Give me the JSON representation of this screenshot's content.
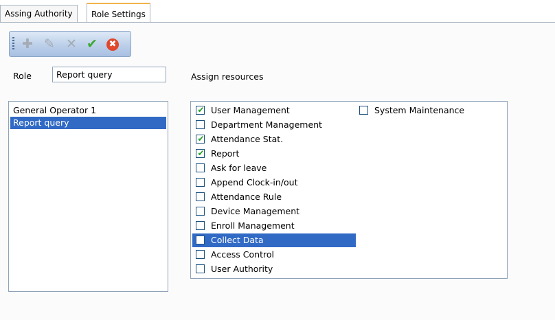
{
  "tabs": [
    {
      "label": "Assing Authority",
      "active": false
    },
    {
      "label": "Role Settings",
      "active": true
    }
  ],
  "toolbar": {
    "buttons": [
      {
        "icon": "plus-icon",
        "glyph": "✚",
        "enabled": false
      },
      {
        "icon": "edit-icon",
        "glyph": "✎",
        "enabled": false
      },
      {
        "icon": "delete-icon",
        "glyph": "✕",
        "enabled": false
      },
      {
        "icon": "check-icon",
        "glyph": "✔",
        "enabled": true
      },
      {
        "icon": "cancel-icon",
        "glyph": "✖",
        "enabled": true
      }
    ]
  },
  "role": {
    "label": "Role",
    "value": "Report query"
  },
  "roles_list": {
    "items": [
      {
        "label": "General Operator 1",
        "selected": false
      },
      {
        "label": "Report query",
        "selected": true
      }
    ]
  },
  "resources": {
    "label": "Assign resources",
    "items": [
      {
        "label": "User Management",
        "checked": true
      },
      {
        "label": "Department Management",
        "checked": false
      },
      {
        "label": "Attendance Stat.",
        "checked": true
      },
      {
        "label": "Report",
        "checked": true
      },
      {
        "label": "Ask for leave",
        "checked": false
      },
      {
        "label": "Append Clock-in/out",
        "checked": false
      },
      {
        "label": "Attendance Rule",
        "checked": false
      },
      {
        "label": "Device Management",
        "checked": false
      },
      {
        "label": "Enroll Management",
        "checked": false
      },
      {
        "label": "Collect Data",
        "checked": false,
        "highlighted": true
      },
      {
        "label": "Access Control",
        "checked": false
      },
      {
        "label": "User Authority",
        "checked": false
      },
      {
        "label": "System Maintenance",
        "checked": false
      }
    ]
  },
  "colors": {
    "selection": "#316ac5",
    "active_tab_accent": "#f0b34a",
    "check_mark": "#21a121",
    "cancel_button": "#e0472b"
  }
}
